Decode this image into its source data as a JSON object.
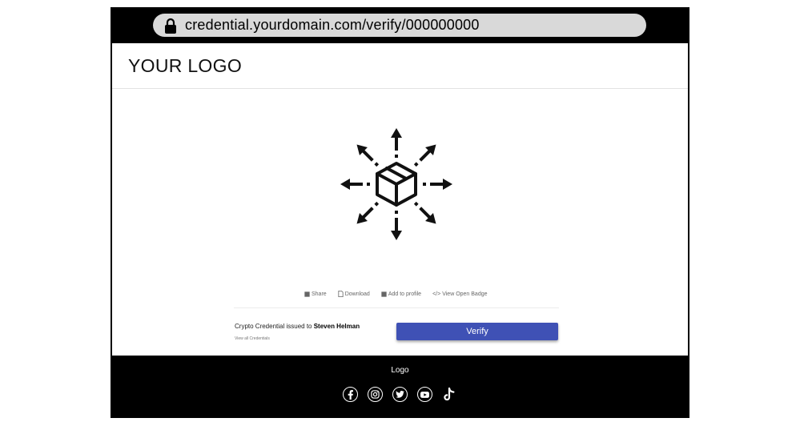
{
  "browser": {
    "url": "credential.yourdomain.com/verify/000000000",
    "lock_icon": "lock-icon"
  },
  "header": {
    "logo_text": "YOUR LOGO"
  },
  "badge": {
    "icon": "box-distribution-icon"
  },
  "actions": {
    "share": "Share",
    "download": "Download",
    "add_profile": "Add to profile",
    "open_badge": "View Open Badge"
  },
  "credential": {
    "issued_prefix": "Crypto Credential issued to ",
    "recipient": "Steven Helman",
    "view_all": "View all Credentials"
  },
  "verify_button": "Verify",
  "footer": {
    "logo": "Logo",
    "social": [
      "facebook-icon",
      "instagram-icon",
      "twitter-icon",
      "youtube-icon",
      "tiktok-icon"
    ]
  },
  "colors": {
    "frame": "#000000",
    "accent": "#3f51b5",
    "address_bar": "#d9d9d9"
  }
}
